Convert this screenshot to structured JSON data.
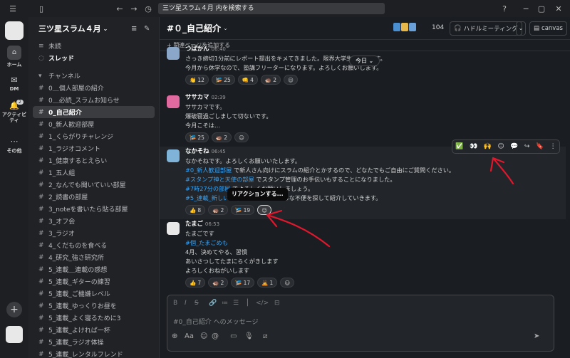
{
  "search": {
    "placeholder": "三ツ星スラム４月 内を検索する"
  },
  "rail": {
    "home": "ホーム",
    "dm": "DM",
    "activity": "アクティビティ",
    "activity_badge": "2",
    "more": "その他"
  },
  "workspace": {
    "name": "三ツ星スラム４月"
  },
  "sidebar": {
    "unread": "未読",
    "threads": "スレッド",
    "channels_header": "チャンネル",
    "channels": [
      "0＿個人部屋の紹介",
      "0＿必読_スラムお知らせ",
      "0_自己紹介",
      "0_新人歓迎部屋",
      "1_くらがりチャレンジ",
      "1_ラジオコメント",
      "1_健康するとえらい",
      "1_五人組",
      "2_なんでも聞いていい部屋",
      "2_読書の部屋",
      "3_noteを書いたら貼る部屋",
      "3_オフ会",
      "3_ラジオ",
      "4_くだものを食べる",
      "4_研究_強さ研究所",
      "5_連載＿連載の感想",
      "5_連載_ギターの練習",
      "5_連載_ご機嫌レベル",
      "5_連載_ゆっくりお昼を",
      "5_連載_よく寝るために3",
      "5_連載_よければ一杯",
      "5_連載_ラジオ体操",
      "5_連載_レンタルフレンド"
    ],
    "active_index": 2
  },
  "channel": {
    "name": "#０_自己紹介",
    "member_count": "104",
    "huddle_label": "ハドルミーティング",
    "canvas_label": "canvas",
    "bookmark_label": "関連ページを追加する"
  },
  "today_label": "今日",
  "messages": [
    {
      "author": "つばかん",
      "time": "06:40",
      "lines": [
        "さっき締切1分前にレポート提出をキメてきました。限界大学生やってます。",
        "今月から休学なので、塾講フリーターになります。よろしくお願いします。"
      ],
      "reactions": [
        {
          "e": "👏",
          "n": "12"
        },
        {
          "e": "🎏",
          "n": "25"
        },
        {
          "e": "👊",
          "n": "4"
        },
        {
          "e": "🦔",
          "n": "2"
        }
      ]
    },
    {
      "author": "ササカマ",
      "time": "02:39",
      "lines": [
        "ササカマです。",
        "爆破寝過ごしまして切ないです。",
        "今月こそは…"
      ],
      "reactions": [
        {
          "e": "🎏",
          "n": "25"
        },
        {
          "e": "🦔",
          "n": "2"
        }
      ]
    },
    {
      "author": "なかそね",
      "time": "06:45",
      "lines": [
        "なかそねです。よろしくお願いいたします。"
      ],
      "link_lines": [
        {
          "link": "#0_新人歓迎部屋",
          "text": " で新人さん向けにスラムの紹介とかするので、どなたでもご自由にご質問ください。"
        },
        {
          "link": "#スタンプ神と天使の部屋",
          "text": " でスタンプ管理のお手伝いもすることになりました。"
        },
        {
          "link": "#7時27分の部屋",
          "text": " でよろしくお願いしましょう。"
        },
        {
          "link": "#5_連載_新しい",
          "text": " で物件探しのいろいろな不便を探して紹介していきます。"
        }
      ],
      "reactions": [
        {
          "e": "👍",
          "n": "8"
        },
        {
          "e": "🦔",
          "n": "2"
        },
        {
          "e": "🎏",
          "n": "19"
        }
      ]
    },
    {
      "author": "たまご",
      "time": "06:53",
      "lines": [
        "たまごです"
      ],
      "tag": "#個_たまごめも",
      "lines2": [
        "4月、決めてやる、習慣",
        "あいさつしてたまにらくがきします",
        "よろしくおねがいします"
      ],
      "reactions": [
        {
          "e": "👍",
          "n": "7"
        },
        {
          "e": "🦔",
          "n": "2"
        },
        {
          "e": "🎏",
          "n": "17"
        },
        {
          "e": "🙇",
          "n": "1"
        }
      ]
    }
  ],
  "tooltip": "リアクションする...",
  "composer": {
    "placeholder": "#0_自己紹介 へのメッセージ"
  },
  "colors": {
    "link": "#36a3f7",
    "annotation": "#e0182d",
    "bg": "#1a1d21"
  }
}
